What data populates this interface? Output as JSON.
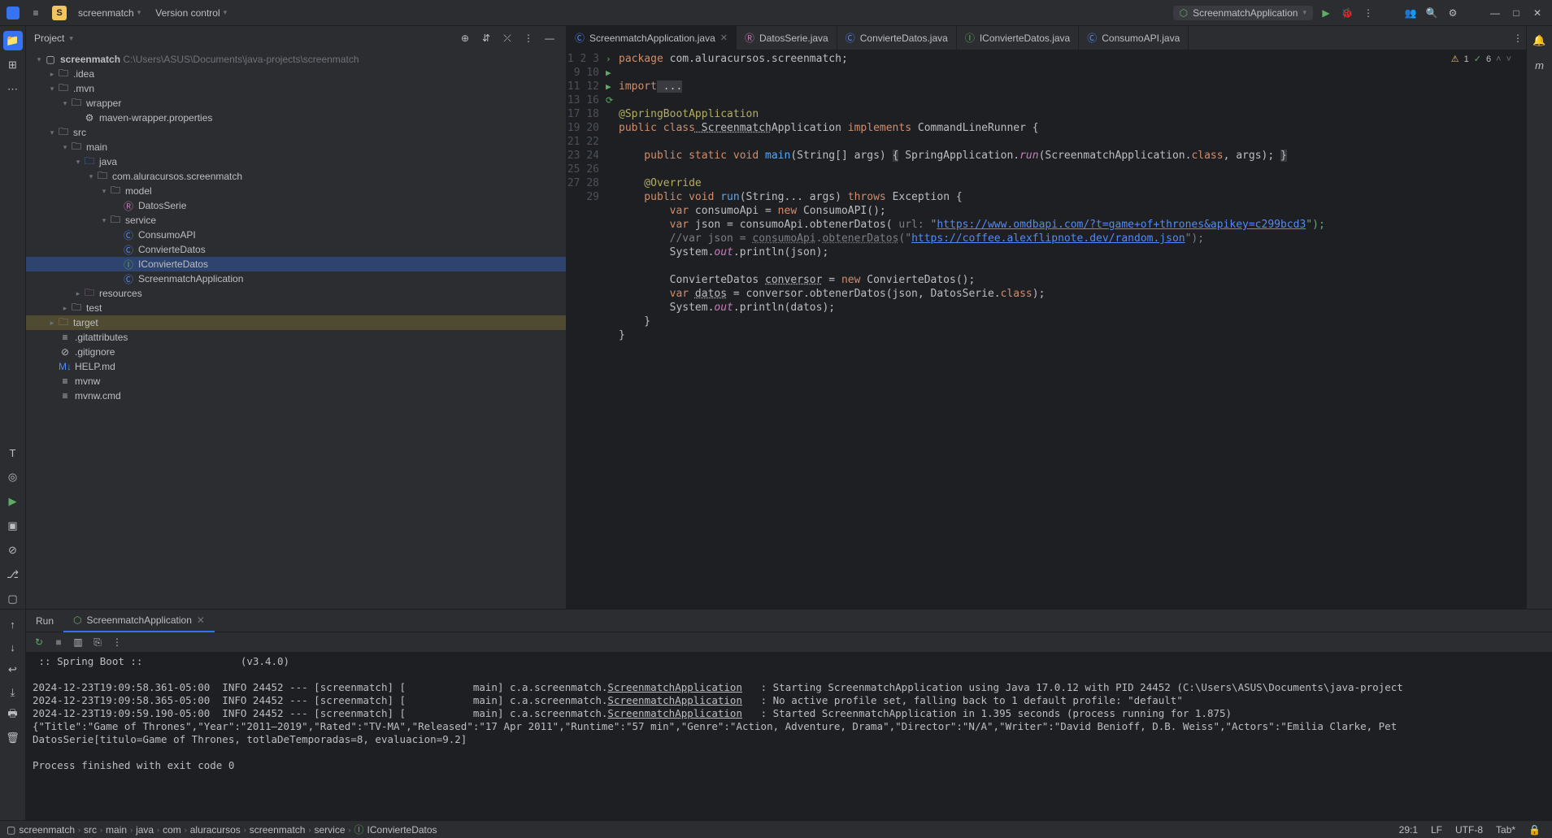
{
  "titlebar": {
    "menu_icon": "≡",
    "project_badge": "S",
    "project_name": "screenmatch",
    "vcs": "Version control",
    "run_config": "ScreenmatchApplication"
  },
  "project_panel": {
    "title": "Project",
    "root": "screenmatch",
    "root_path": "C:\\Users\\ASUS\\Documents\\java-projects\\screenmatch",
    "nodes": {
      "idea": ".idea",
      "mvn": ".mvn",
      "wrapper": "wrapper",
      "maven_props": "maven-wrapper.properties",
      "src": "src",
      "main": "main",
      "java": "java",
      "pkg": "com.aluracursos.screenmatch",
      "model": "model",
      "datosserie": "DatosSerie",
      "service": "service",
      "consumoapi": "ConsumoAPI",
      "conviertedatos": "ConvierteDatos",
      "iconviertedatos": "IConvierteDatos",
      "screenmatchapp": "ScreenmatchApplication",
      "resources": "resources",
      "test": "test",
      "target": "target",
      "gitattributes": ".gitattributes",
      "gitignore": ".gitignore",
      "help": "HELP.md",
      "mvnw": "mvnw",
      "mvnwcmd": "mvnw.cmd"
    }
  },
  "tabs": [
    {
      "label": "ScreenmatchApplication.java",
      "active": true,
      "icon": "C"
    },
    {
      "label": "DatosSerie.java",
      "icon": "R"
    },
    {
      "label": "ConvierteDatos.java",
      "icon": "C"
    },
    {
      "label": "IConvierteDatos.java",
      "icon": "I"
    },
    {
      "label": "ConsumoAPI.java",
      "icon": "C"
    }
  ],
  "editor": {
    "warnings": "1",
    "oks": "6",
    "lines": {
      "l1a": "package",
      "l1b": " com.aluracursos.screenmatch;",
      "l3a": "import",
      "l3b": " ...",
      "l10": "@SpringBootApplication",
      "l11a": "public class",
      "l11b": " Screenmatch",
      "l11c": "Application ",
      "l11d": "implements",
      "l11e": " CommandLineRunner {",
      "l13a": "    public static void",
      "l13b": " main",
      "l13c": "(String[] args) ",
      "l13d": "{",
      "l13e": " SpringApplication.",
      "l13f": "run",
      "l13g": "(ScreenmatchApplication.",
      "l13h": "class",
      "l13i": ", args); ",
      "l13j": "}",
      "l17": "    @Override",
      "l18a": "    public void",
      "l18b": " run",
      "l18c": "(String... args) ",
      "l18d": "throws",
      "l18e": " Exception {",
      "l19a": "        var",
      "l19b": " consumoApi = ",
      "l19c": "new",
      "l19d": " ConsumoAPI();",
      "l20a": "        var",
      "l20b": " json = consumoApi.obtenerDatos(",
      "l20c": " url: ",
      "l20d": "\"",
      "l20e": "https://www.omdbapi.com/?t=game+of+thrones&apikey=c299bcd3",
      "l20f": "\");",
      "l21a": "        //var json = ",
      "l21b": "consumoApi",
      "l21c": ".",
      "l21d": "obtenerDatos",
      "l21e": "(",
      "l21f": "\"",
      "l21g": "https://coffee.alexflipnote.dev/random.json",
      "l21h": "\");",
      "l22a": "        System.",
      "l22b": "out",
      "l22c": ".println(json);",
      "l24a": "        ConvierteDatos ",
      "l24b": "conversor",
      "l24c": " = ",
      "l24d": "new",
      "l24e": " ConvierteDatos();",
      "l25a": "        var",
      "l25b": " ",
      "l25c": "datos",
      "l25d": " = conversor.obtenerDatos(json, DatosSerie.",
      "l25e": "class",
      "l25f": ");",
      "l26a": "        System.",
      "l26b": "out",
      "l26c": ".println(datos);",
      "l27": "    }",
      "l28": "}"
    }
  },
  "run_panel": {
    "tab_run": "Run",
    "tab_app": "ScreenmatchApplication",
    "console_lines": {
      "banner": " :: Spring Boot ::                (v3.4.0)",
      "l1": "2024-12-23T19:09:58.361-05:00  INFO 24452 --- [screenmatch] [           main] c.a.screenmatch.",
      "l1u": "ScreenmatchApplication",
      "l1b": "   : Starting ScreenmatchApplication using Java 17.0.12 with PID 24452 (C:\\Users\\ASUS\\Documents\\java-project",
      "l2": "2024-12-23T19:09:58.365-05:00  INFO 24452 --- [screenmatch] [           main] c.a.screenmatch.",
      "l2u": "ScreenmatchApplication",
      "l2b": "   : No active profile set, falling back to 1 default profile: \"default\"",
      "l3": "2024-12-23T19:09:59.190-05:00  INFO 24452 --- [screenmatch] [           main] c.a.screenmatch.",
      "l3u": "ScreenmatchApplication",
      "l3b": "   : Started ScreenmatchApplication in 1.395 seconds (process running for 1.875)",
      "l4": "{\"Title\":\"Game of Thrones\",\"Year\":\"2011–2019\",\"Rated\":\"TV-MA\",\"Released\":\"17 Apr 2011\",\"Runtime\":\"57 min\",\"Genre\":\"Action, Adventure, Drama\",\"Director\":\"N/A\",\"Writer\":\"David Benioff, D.B. Weiss\",\"Actors\":\"Emilia Clarke, Pet",
      "l5": "DatosSerie[titulo=Game of Thrones, totlaDeTemporadas=8, evaluacion=9.2]",
      "l6": "",
      "l7": "Process finished with exit code 0"
    }
  },
  "breadcrumbs": [
    "screenmatch",
    "src",
    "main",
    "java",
    "com",
    "aluracursos",
    "screenmatch",
    "service",
    "IConvierteDatos"
  ],
  "statusbar": {
    "pos": "29:1",
    "lf": "LF",
    "enc": "UTF-8",
    "indent": "Tab*"
  }
}
